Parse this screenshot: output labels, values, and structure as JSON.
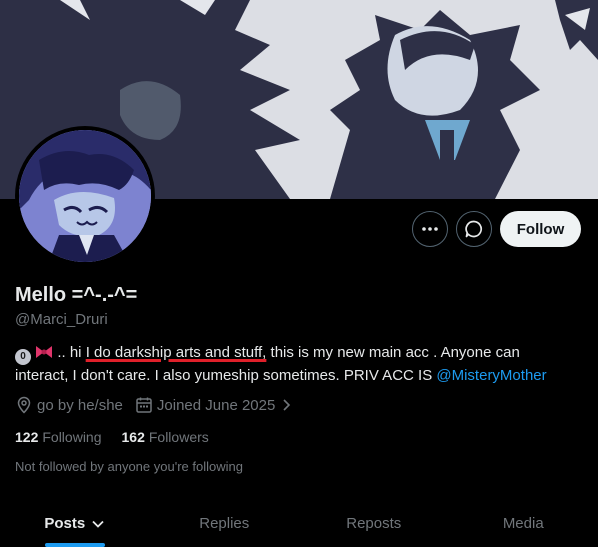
{
  "profile": {
    "display_name": "Mello =^-.-^=",
    "handle": "@Marci_Druri",
    "bio": {
      "badge_glyph": "0",
      "pre": " .. hi ",
      "underlined": "I do darkship arts and stuff,",
      "post": " this is my new main acc . Anyone can interact, I don't care. I also yumeship sometimes. PRIV ACC IS ",
      "mention": "@MisteryMother"
    },
    "location": "go by he/she",
    "joined": "Joined June 2025",
    "following_count": "122",
    "following_label": "Following",
    "followers_count": "162",
    "followers_label": "Followers",
    "not_followed_note": "Not followed by anyone you're following"
  },
  "actions": {
    "follow_label": "Follow"
  },
  "tabs": [
    {
      "label": "Posts"
    },
    {
      "label": "Replies"
    },
    {
      "label": "Reposts"
    },
    {
      "label": "Media"
    }
  ],
  "colors": {
    "accent": "#1d9bf0",
    "underline": "#e0202a",
    "muted": "#71767b"
  },
  "icons": {
    "more": "more-icon",
    "message": "message-icon",
    "location": "location-icon",
    "calendar": "calendar-icon",
    "chevron": "chevron-right-icon",
    "tab_chevron": "chevron-down-icon"
  }
}
